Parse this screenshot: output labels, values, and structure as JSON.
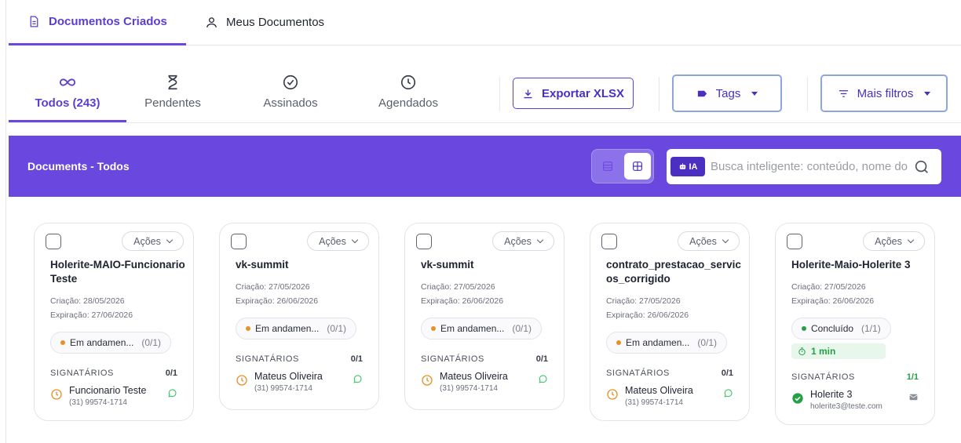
{
  "top_tabs": {
    "created": "Documentos Criados",
    "mine": "Meus Documentos"
  },
  "filters": {
    "all": "Todos (243)",
    "pending": "Pendentes",
    "signed": "Assinados",
    "scheduled": "Agendados",
    "export": "Exportar XLSX",
    "tags": "Tags",
    "more_filters": "Mais filtros"
  },
  "banner": {
    "title": "Documents - Todos",
    "ia_badge": "IA",
    "search_placeholder": "Busca inteligente: conteúdo, nome do documento..."
  },
  "cards": [
    {
      "actions": "Ações",
      "title": "Holerite-MAIO-Funcionario Teste",
      "created": "Criação: 28/05/2026",
      "expires": "Expiração: 27/06/2026",
      "status": "Em andamen...",
      "status_count": "(0/1)",
      "status_color": "#e8902a",
      "signers_label": "SIGNATÁRIOS",
      "signers_count": "0/1",
      "signer_name": "Funcionario Teste",
      "signer_contact": "(31) 99574-1714",
      "signer_icon": "clock-icon",
      "contact_icon": "whatsapp-icon"
    },
    {
      "actions": "Ações",
      "title": "vk-summit",
      "created": "Criação: 27/05/2026",
      "expires": "Expiração: 26/06/2026",
      "status": "Em andamen...",
      "status_count": "(0/1)",
      "status_color": "#e8902a",
      "signers_label": "SIGNATÁRIOS",
      "signers_count": "0/1",
      "signer_name": "Mateus Oliveira",
      "signer_contact": "(31) 99574-1714",
      "signer_icon": "clock-icon",
      "contact_icon": "whatsapp-icon"
    },
    {
      "actions": "Ações",
      "title": "vk-summit",
      "created": "Criação: 27/05/2026",
      "expires": "Expiração: 26/06/2026",
      "status": "Em andamen...",
      "status_count": "(0/1)",
      "status_color": "#e8902a",
      "signers_label": "SIGNATÁRIOS",
      "signers_count": "0/1",
      "signer_name": "Mateus Oliveira",
      "signer_contact": "(31) 99574-1714",
      "signer_icon": "clock-icon",
      "contact_icon": "whatsapp-icon"
    },
    {
      "actions": "Ações",
      "title": "contrato_prestacao_servicos_corrigido",
      "created": "Criação: 27/05/2026",
      "expires": "Expiração: 26/06/2026",
      "status": "Em andamen...",
      "status_count": "(0/1)",
      "status_color": "#e8902a",
      "signers_label": "SIGNATÁRIOS",
      "signers_count": "0/1",
      "signer_name": "Mateus Oliveira",
      "signer_contact": "(31) 99574-1714",
      "signer_icon": "clock-icon",
      "contact_icon": "whatsapp-icon"
    },
    {
      "actions": "Ações",
      "title": "Holerite-Maio-Holerite 3",
      "created": "Criação: 27/05/2026",
      "expires": "Expiração: 26/06/2026",
      "status": "Concluído",
      "status_count": "(1/1)",
      "status_color": "#26a046",
      "timer": "1 min",
      "signers_label": "SIGNATÁRIOS",
      "signers_count": "1/1",
      "signer_name": "Holerite 3",
      "signer_contact": "holerite3@teste.com",
      "signer_icon": "check-circle-icon",
      "contact_icon": "mail-icon"
    }
  ],
  "colors": {
    "accent": "#6a48e0",
    "accent_dark": "#4a2fc0",
    "pending": "#e8902a",
    "success": "#26a046"
  }
}
